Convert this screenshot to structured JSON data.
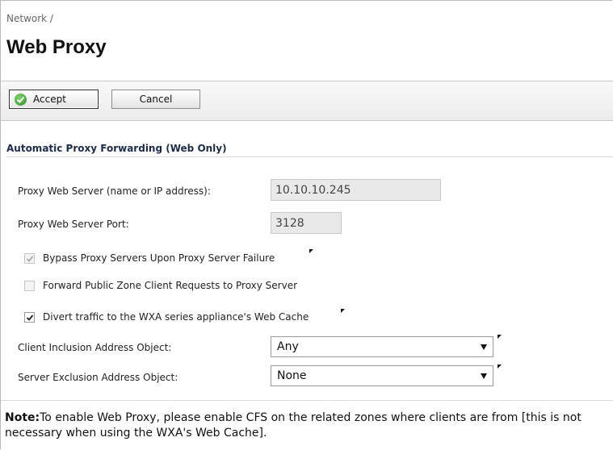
{
  "header": {
    "breadcrumb": "Network /",
    "title": "Web Proxy"
  },
  "toolbar": {
    "accept_label": "Accept",
    "cancel_label": "Cancel"
  },
  "section": {
    "title": "Automatic Proxy Forwarding (Web Only)"
  },
  "fields": {
    "proxy_server_label": "Proxy Web Server (name or IP address):",
    "proxy_server_value": "10.10.10.245",
    "proxy_port_label": "Proxy Web Server Port:",
    "proxy_port_value": "3128"
  },
  "checkboxes": [
    {
      "label": "Bypass Proxy Servers Upon Proxy Server Failure",
      "checked": true,
      "disabled": true
    },
    {
      "label": "Forward Public Zone Client Requests to Proxy Server",
      "checked": false,
      "disabled": true
    },
    {
      "label": "Divert traffic to the WXA series appliance's Web Cache",
      "checked": true,
      "disabled": false
    }
  ],
  "selects": {
    "client_inclusion_label": "Client Inclusion Address Object:",
    "client_inclusion_value": "Any",
    "server_exclusion_label": "Server Exclusion Address Object:",
    "server_exclusion_value": "None"
  },
  "note": {
    "prefix": "Note:",
    "text": "To enable Web Proxy, please enable CFS on the related zones where clients are from [this is not necessary when using the WXA's Web Cache]."
  },
  "colors": {
    "accent_green": "#2f8f2a",
    "section_title": "#1c2c4c"
  }
}
